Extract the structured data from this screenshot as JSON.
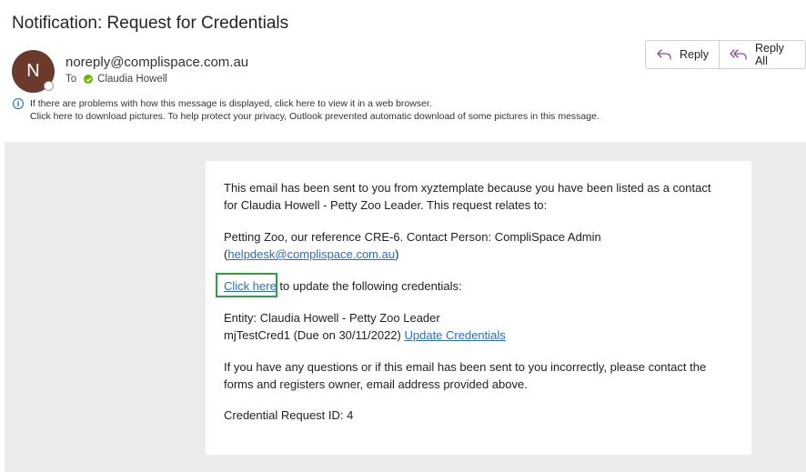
{
  "email": {
    "subject": "Notification: Request for Credentials",
    "sender_initial": "N",
    "sender": "noreply@complispace.com.au",
    "to_label": "To",
    "recipient": "Claudia Howell"
  },
  "toolbar": {
    "reply_label": "Reply",
    "reply_all_label": "Reply All"
  },
  "info": {
    "line1": "If there are problems with how this message is displayed, click here to view it in a web browser.",
    "line2": "Click here to download pictures. To help protect your privacy, Outlook prevented automatic download of some pictures in this message."
  },
  "body": {
    "p1_line1": "This email has been sent to you from xyztemplate because you have been listed as a contact",
    "p1_line2": "for Claudia Howell - Petty Zoo Leader. This request relates to:",
    "p2_line1": "Petting Zoo, our reference CRE-6. Contact Person: CompliSpace Admin",
    "p2_open": "(",
    "p2_email": "helpdesk@complispace.com.au",
    "p2_close": ")",
    "click_here": "Click here",
    "p3_rest": " to update the following credentials:",
    "entity_line": "Entity: Claudia Howell - Petty Zoo Leader",
    "cred_line": "mjTestCred1 (Due on 30/11/2022) ",
    "update_link": "Update Credentials",
    "p5_line1": "If you have any questions or if this email has been sent to you incorrectly, please contact the",
    "p5_line2": "forms and registers owner, email address provided above.",
    "request_id": "Credential Request ID: 4"
  },
  "colors": {
    "link": "#2a6ebb",
    "highlight": "#2f9e44",
    "avatar": "#6b3a2d",
    "presence_check": "#6bb700"
  }
}
